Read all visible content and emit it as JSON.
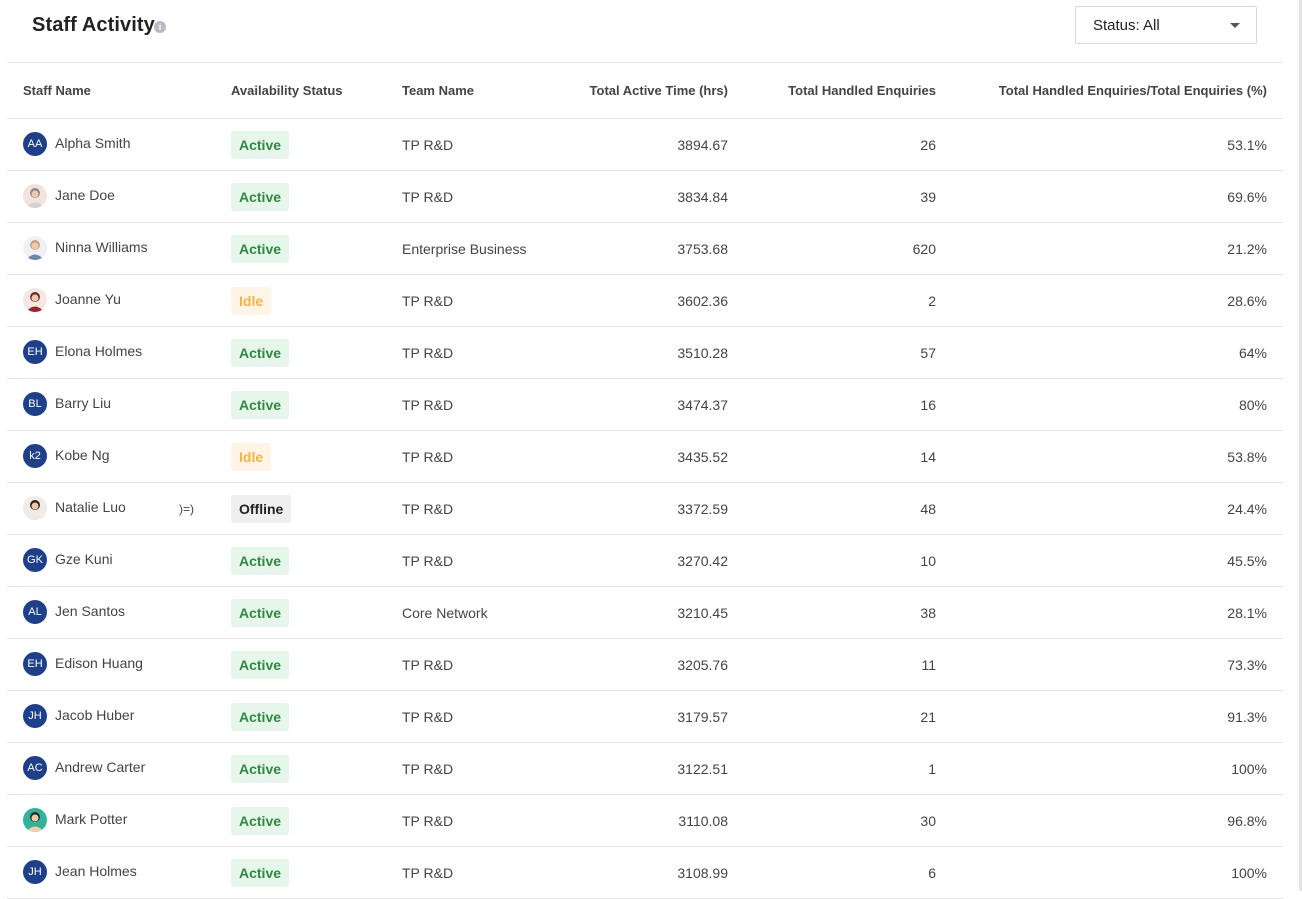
{
  "header": {
    "title": "Staff Activity",
    "info_icon": "info-icon",
    "status_filter": "Status: All"
  },
  "table": {
    "columns": [
      "Staff Name",
      "Availability Status",
      "Team Name",
      "Total Active Time (hrs)",
      "Total Handled Enquiries",
      "Total Handled Enquiries/Total Enquiries (%)"
    ],
    "rows": [
      {
        "initials": "AA",
        "photo": false,
        "name": "Alpha Smith",
        "status": "Active",
        "team": "TP R&D",
        "time": "3894.67",
        "enquiries": "26",
        "pct": "53.1%",
        "leak": ""
      },
      {
        "initials": "",
        "photo": true,
        "name": "Jane Doe",
        "status": "Active",
        "team": "TP R&D",
        "time": "3834.84",
        "enquiries": "39",
        "pct": "69.6%",
        "leak": ""
      },
      {
        "initials": "",
        "photo": true,
        "name": "Ninna Williams",
        "status": "Active",
        "team": "Enterprise Business",
        "time": "3753.68",
        "enquiries": "620",
        "pct": "21.2%",
        "leak": ""
      },
      {
        "initials": "",
        "photo": true,
        "name": "Joanne Yu",
        "status": "Idle",
        "team": "TP R&D",
        "time": "3602.36",
        "enquiries": "2",
        "pct": "28.6%",
        "leak": ""
      },
      {
        "initials": "EH",
        "photo": false,
        "name": "Elona Holmes",
        "status": "Active",
        "team": "TP R&D",
        "time": "3510.28",
        "enquiries": "57",
        "pct": "64%",
        "leak": ""
      },
      {
        "initials": "BL",
        "photo": false,
        "name": "Barry Liu",
        "status": "Active",
        "team": "TP R&D",
        "time": "3474.37",
        "enquiries": "16",
        "pct": "80%",
        "leak": ""
      },
      {
        "initials": "k2",
        "photo": false,
        "name": "Kobe Ng",
        "status": "Idle",
        "team": "TP R&D",
        "time": "3435.52",
        "enquiries": "14",
        "pct": "53.8%",
        "leak": ""
      },
      {
        "initials": "",
        "photo": true,
        "name": "Natalie Luo",
        "status": "Offline",
        "team": "TP R&D",
        "time": "3372.59",
        "enquiries": "48",
        "pct": "24.4%",
        "leak": ")=)"
      },
      {
        "initials": "GK",
        "photo": false,
        "name": "Gze Kuni",
        "status": "Active",
        "team": "TP R&D",
        "time": "3270.42",
        "enquiries": "10",
        "pct": "45.5%",
        "leak": ""
      },
      {
        "initials": "AL",
        "photo": false,
        "name": "Jen Santos",
        "status": "Active",
        "team": "Core Network",
        "time": "3210.45",
        "enquiries": "38",
        "pct": "28.1%",
        "leak": ""
      },
      {
        "initials": "EH",
        "photo": false,
        "name": "Edison Huang",
        "status": "Active",
        "team": "TP R&D",
        "time": "3205.76",
        "enquiries": "11",
        "pct": "73.3%",
        "leak": ""
      },
      {
        "initials": "JH",
        "photo": false,
        "name": "Jacob Huber",
        "status": "Active",
        "team": "TP R&D",
        "time": "3179.57",
        "enquiries": "21",
        "pct": "91.3%",
        "leak": ""
      },
      {
        "initials": "AC",
        "photo": false,
        "name": "Andrew Carter",
        "status": "Active",
        "team": "TP R&D",
        "time": "3122.51",
        "enquiries": "1",
        "pct": "100%",
        "leak": ""
      },
      {
        "initials": "",
        "photo": true,
        "name": "Mark Potter",
        "status": "Active",
        "team": "TP R&D",
        "time": "3110.08",
        "enquiries": "30",
        "pct": "96.8%",
        "leak": ""
      },
      {
        "initials": "JH",
        "photo": false,
        "name": "Jean Holmes",
        "status": "Active",
        "team": "TP R&D",
        "time": "3108.99",
        "enquiries": "6",
        "pct": "100%",
        "leak": ""
      }
    ]
  },
  "colors": {
    "active_bg": "#e6f6ea",
    "active_text": "#2d8a3e",
    "idle_bg": "#fff5e6",
    "idle_text": "#f6b33d",
    "offline_bg": "#efefef",
    "avatar_bg": "#1e3f8a"
  }
}
